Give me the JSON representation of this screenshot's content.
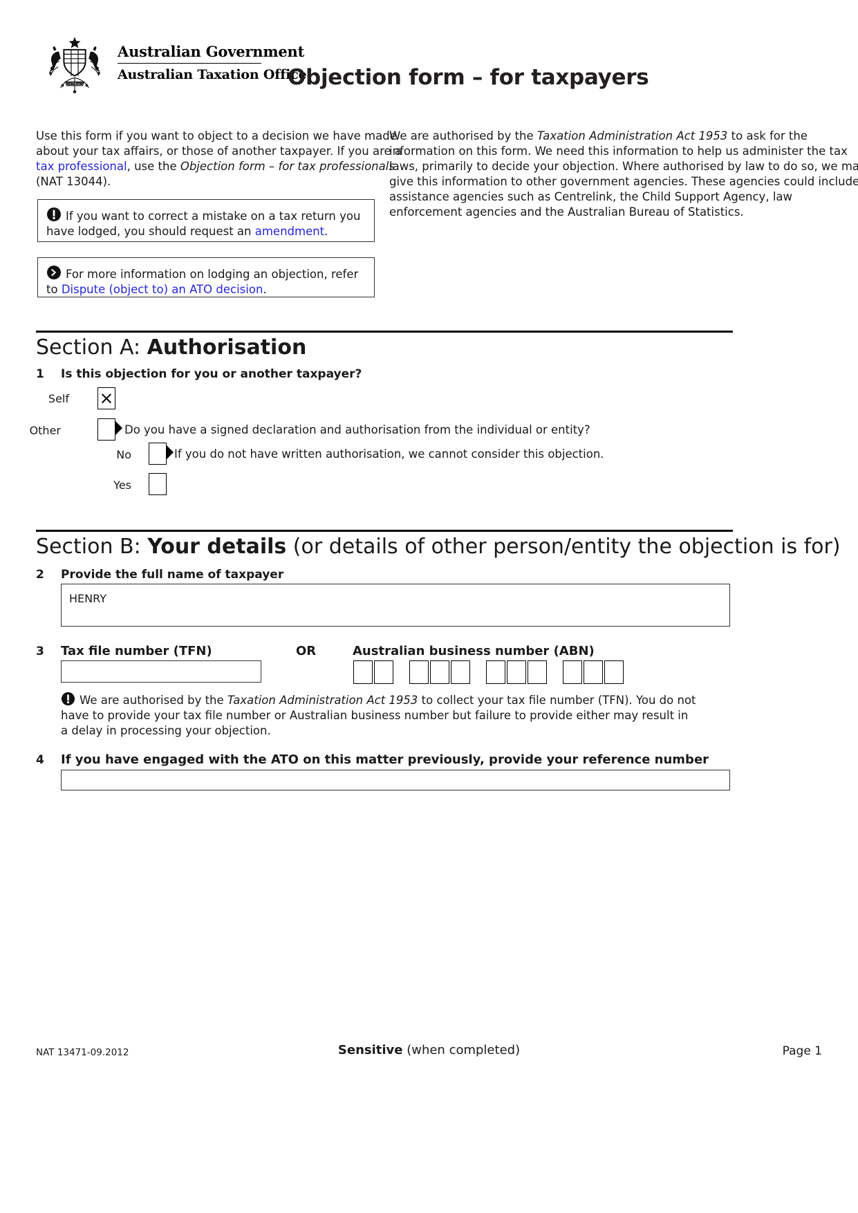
{
  "header": {
    "crest_alt": "australian-coat-of-arms",
    "gov_line1": "Australian Government",
    "gov_line2": "Australian Taxation Office",
    "form_title": "Objection form – for taxpayers"
  },
  "intro": {
    "left_part1": "Use this form if you want to object to a decision we have made about your tax affairs, or those of another taxpayer. If you are a ",
    "left_link": "tax professional",
    "left_part2": ", use the ",
    "left_italic": "Objection form – for tax professionals",
    "left_part3": " (NAT 13044).",
    "right_part1": "We are authorised by the ",
    "right_italic": "Taxation Administration Act 1953",
    "right_part2": " to ask for the information on this form. We need this information to help us administer the tax laws, primarily to decide your objection. Where authorised by law to do so, we may give this information to other government agencies. These agencies could include assistance agencies such as Centrelink, the Child Support Agency, law enforcement agencies and the Australian Bureau of Statistics."
  },
  "callouts": [
    {
      "id": "amendment",
      "icon": "exclamation-circle-icon",
      "text_part1": "If you want to correct a mistake on a tax return you have lodged, you should request an ",
      "link": "amendment",
      "text_part2": "."
    },
    {
      "id": "dispute",
      "icon": "chevron-right-circle-icon",
      "text_part1": "For more information on lodging an objection, refer to ",
      "link": "Dispute (object to) an ATO decision",
      "text_part2": "."
    }
  ],
  "section_a": {
    "label": "Section A: ",
    "title": "Authorisation",
    "q1": {
      "number": "1",
      "text": "Is this objection for you or another taxpayer?",
      "self_label": "Self",
      "self_checked": "×",
      "other_label": "Other",
      "other_note": "Do you have a signed declaration and authorisation from the individual or entity?",
      "no_label": "No",
      "no_note": "If you do not have written authorisation, we cannot consider this objection.",
      "yes_label": "Yes"
    }
  },
  "section_b": {
    "label": "Section B: ",
    "title": "Your details",
    "subtitle": " (or details of other person/entity the objection is for)",
    "q2": {
      "number": "2",
      "text": "Provide the full name of taxpayer",
      "value": "HENRY"
    },
    "q3": {
      "number": "3",
      "tfn_label": "Tax file number (TFN)",
      "or_label": "OR",
      "abn_label": "Australian business number (ABN)",
      "tfn_value": "",
      "abn_groups": [
        2,
        3,
        3,
        3
      ],
      "note_icon": "exclamation-circle-icon",
      "note_part1": "We are authorised by the ",
      "note_italic": "Taxation Administration Act 1953",
      "note_part2": " to collect your tax file number (TFN). You do not have to provide your tax file number or Australian business number but failure to provide either may result in a delay in processing your objection."
    },
    "q4": {
      "number": "4",
      "text": "If you have engaged with the ATO on this matter previously, provide your reference number",
      "value": ""
    }
  },
  "footer": {
    "nat_code": "NAT 13471-09.2012",
    "sensitive_bold": "Sensitive",
    "sensitive_rest": " (when completed)",
    "page": "Page 1"
  }
}
